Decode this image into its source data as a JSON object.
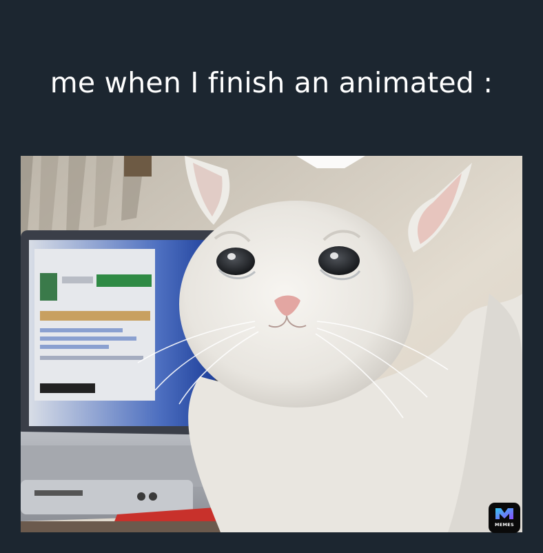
{
  "meme": {
    "caption": "me when I finish an animated :"
  },
  "image": {
    "subject": "crying-white-cat-in-front-of-laptop"
  },
  "badge": {
    "label": "MEMES",
    "colors": {
      "background": "#0a0a0a",
      "gradient_start": "#37c8f0",
      "gradient_end": "#8a4cff"
    }
  },
  "colors": {
    "page_background": "#1c2630",
    "caption_text": "#ffffff"
  }
}
